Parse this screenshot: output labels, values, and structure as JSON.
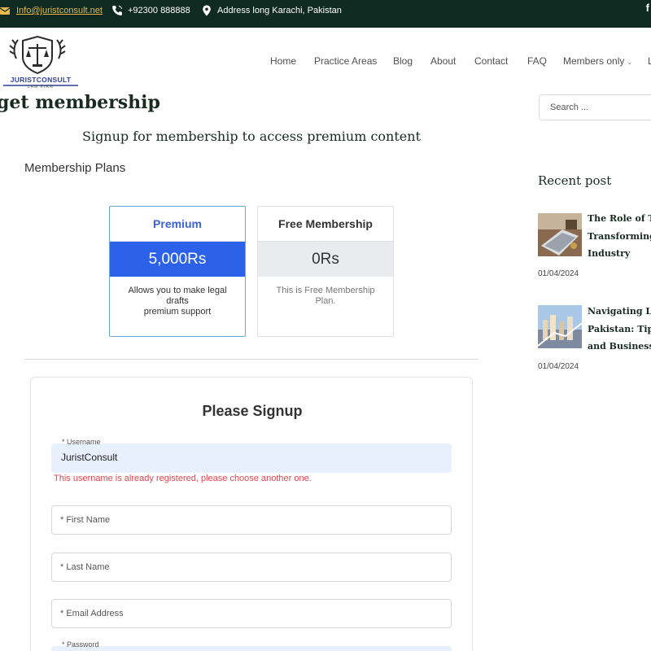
{
  "topbar": {
    "email": "Info@juristconsult.net",
    "phone": "+92300 888888",
    "address": "Address long Karachi, Pakistan",
    "social": "f"
  },
  "header": {
    "logo_text": "JURISTCONSULT",
    "logo_subtext": "LAW FIRM",
    "nav": [
      {
        "label": "Home"
      },
      {
        "label": "Practice Areas"
      },
      {
        "label": "Blog"
      },
      {
        "label": "About"
      },
      {
        "label": "Contact"
      },
      {
        "label": "FAQ"
      },
      {
        "label": "Members only",
        "dropdown": true
      },
      {
        "label": "L"
      }
    ]
  },
  "main": {
    "page_title": "get membership",
    "subtitle": "Signup for membership to access premium content",
    "plans_heading": "Membership Plans",
    "plans": [
      {
        "name": "Premium",
        "price": "5,000Rs",
        "description": "Allows you to make legal drafts\npremium support",
        "selected": true
      },
      {
        "name": "Free Membership",
        "price": "0Rs",
        "description": "This is Free Membership Plan.",
        "selected": false
      }
    ],
    "form": {
      "title": "Please Signup",
      "username_label": "* Username",
      "username_value": "JuristConsult",
      "username_error": "This username is already registered, please choose another one.",
      "first_name_placeholder": "* First Name",
      "last_name_placeholder": "* Last Name",
      "email_placeholder": "* Email Address",
      "password_label": "* Password"
    }
  },
  "sidebar": {
    "search_placeholder": "Search ...",
    "recent_heading": "Recent post",
    "posts": [
      {
        "title_lines": [
          "The Role of Tec",
          "Transforming L",
          "Industry"
        ],
        "date": "01/04/2024"
      },
      {
        "title_lines": [
          "Navigating Leg",
          "Pakistan: Tips f",
          "and Businesses"
        ],
        "date": "01/04/2024"
      }
    ]
  },
  "colors": {
    "topbar_bg": "#0e2a21",
    "accent_blue": "#2c62ea",
    "error_red": "#e0454f",
    "email_gold": "#e8b84a"
  }
}
